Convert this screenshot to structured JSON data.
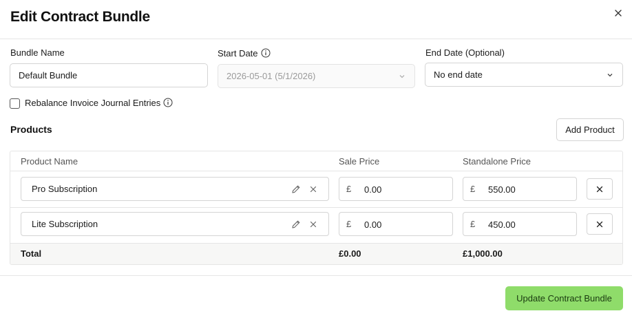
{
  "dialog": {
    "title": "Edit Contract Bundle"
  },
  "form": {
    "bundle_name": {
      "label": "Bundle Name",
      "value": "Default Bundle"
    },
    "start_date": {
      "label": "Start Date",
      "value": "2026-05-01 (5/1/2026)",
      "disabled": true
    },
    "end_date": {
      "label": "End Date (Optional)",
      "value": "No end date"
    },
    "rebalance": {
      "label": "Rebalance Invoice Journal Entries",
      "checked": false
    }
  },
  "products": {
    "title": "Products",
    "add_label": "Add Product",
    "columns": [
      "Product Name",
      "Sale Price",
      "Standalone Price"
    ],
    "currency_symbol": "£",
    "rows": [
      {
        "name": "Pro Subscription",
        "sale_price": "0.00",
        "standalone_price": "550.00"
      },
      {
        "name": "Lite Subscription",
        "sale_price": "0.00",
        "standalone_price": "450.00"
      }
    ],
    "total": {
      "label": "Total",
      "sale_price": "£0.00",
      "standalone_price": "£1,000.00"
    }
  },
  "footer": {
    "submit_label": "Update Contract Bundle"
  },
  "colors": {
    "primary_button": "#8fdc6a",
    "border": "#d4d4d4"
  },
  "icons": [
    "close-icon",
    "info-icon",
    "chevron-down-icon",
    "pencil-icon",
    "remove-icon"
  ]
}
